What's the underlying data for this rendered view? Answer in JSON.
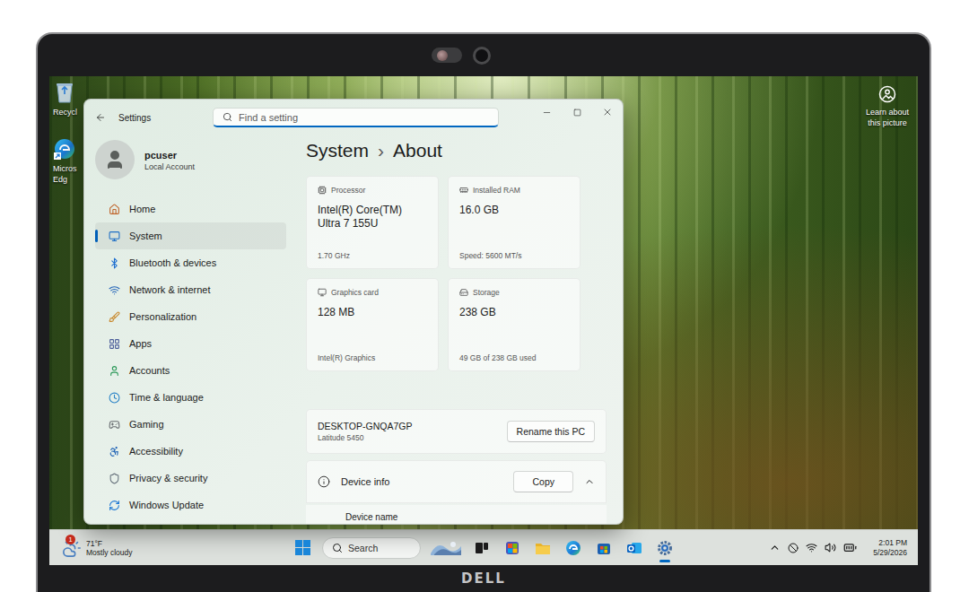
{
  "desktop": {
    "icons": [
      {
        "lines": [
          "Recycl"
        ]
      },
      {
        "lines": [
          "Micros",
          "Edg"
        ]
      }
    ],
    "spotlight": {
      "lines": [
        "Learn about",
        "this picture"
      ]
    }
  },
  "window": {
    "title": "Settings",
    "search": {
      "placeholder": "Find a setting"
    }
  },
  "user": {
    "name": "pcuser",
    "account": "Local Account"
  },
  "nav": [
    {
      "label": "Home",
      "selected": false
    },
    {
      "label": "System",
      "selected": true
    },
    {
      "label": "Bluetooth & devices",
      "selected": false
    },
    {
      "label": "Network & internet",
      "selected": false
    },
    {
      "label": "Personalization",
      "selected": false
    },
    {
      "label": "Apps",
      "selected": false
    },
    {
      "label": "Accounts",
      "selected": false
    },
    {
      "label": "Time & language",
      "selected": false
    },
    {
      "label": "Gaming",
      "selected": false
    },
    {
      "label": "Accessibility",
      "selected": false
    },
    {
      "label": "Privacy & security",
      "selected": false
    },
    {
      "label": "Windows Update",
      "selected": false
    }
  ],
  "breadcrumb": {
    "parent": "System",
    "separator": "›",
    "current": "About"
  },
  "specs": [
    {
      "label": "Processor",
      "value": "Intel(R) Core(TM) Ultra 7 155U",
      "detail": "1.70 GHz"
    },
    {
      "label": "Installed RAM",
      "value": "16.0 GB",
      "detail": "Speed: 5600 MT/s"
    },
    {
      "label": "Graphics card",
      "value": "128 MB",
      "detail": "Intel(R) Graphics"
    },
    {
      "label": "Storage",
      "value": "238 GB",
      "detail": "49 GB of 238 GB used"
    }
  ],
  "device": {
    "name": "DESKTOP-GNQA7GP",
    "model": "Latitude 5450",
    "button": "Rename this PC"
  },
  "device_info": {
    "title": "Device info",
    "button": "Copy",
    "expanded": true,
    "rows": [
      "Device name"
    ]
  },
  "taskbar": {
    "weather": {
      "temperature": "71°F",
      "condition": "Mostly cloudy",
      "badge": "1"
    },
    "search": {
      "placeholder": "Search"
    },
    "apps": [
      {
        "kind": "highlight",
        "active": false
      },
      {
        "kind": "taskview",
        "active": false
      },
      {
        "kind": "teams",
        "active": false
      },
      {
        "kind": "explorer",
        "active": false
      },
      {
        "kind": "edge",
        "active": false
      },
      {
        "kind": "store",
        "active": false
      },
      {
        "kind": "outlook",
        "active": false
      },
      {
        "kind": "settings",
        "active": true
      }
    ],
    "clock": {
      "time": "2:01 PM",
      "date": "5/29/2026"
    }
  },
  "bezel": {
    "brand": "DELL"
  }
}
